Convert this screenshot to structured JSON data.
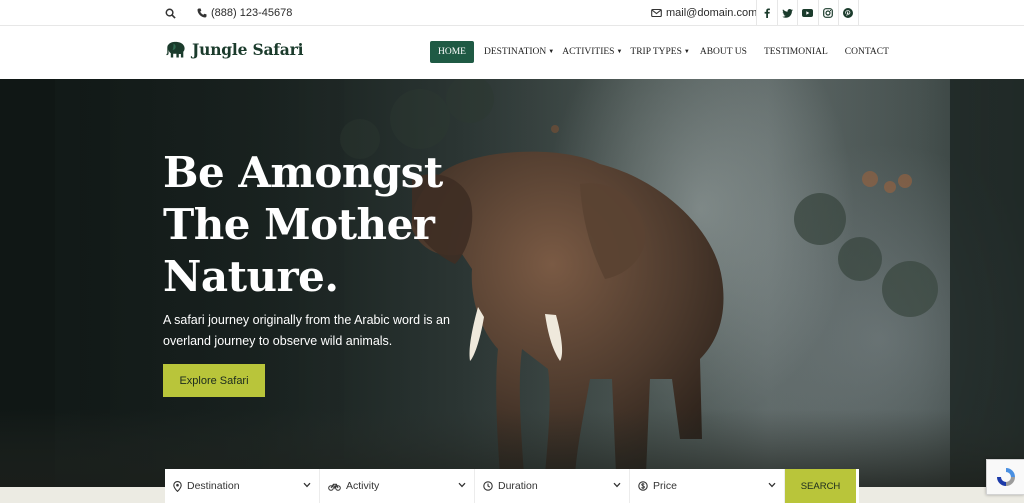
{
  "topbar": {
    "phone": "(888) 123-45678",
    "email": "mail@domain.com",
    "social": [
      "facebook-icon",
      "twitter-icon",
      "youtube-icon",
      "instagram-icon",
      "pinterest-icon"
    ]
  },
  "header": {
    "logo_text": "Jungle Safari",
    "nav": [
      {
        "label": "Home",
        "dropdown": false,
        "active": true
      },
      {
        "label": "Destination",
        "dropdown": true
      },
      {
        "label": "Activities",
        "dropdown": true
      },
      {
        "label": "Trip Types",
        "dropdown": true
      },
      {
        "label": "About Us",
        "dropdown": false
      },
      {
        "label": "Testimonial",
        "dropdown": false
      },
      {
        "label": "Contact",
        "dropdown": false
      }
    ]
  },
  "hero": {
    "title_line1": "Be Amongst",
    "title_line2": "The Mother",
    "title_line3": "Nature.",
    "subtitle": "A safari journey originally from the Arabic word is an overland journey to observe wild animals.",
    "cta_label": "Explore Safari"
  },
  "search": {
    "fields": [
      {
        "label": "Destination",
        "icon": "map-pin-icon"
      },
      {
        "label": "Activity",
        "icon": "bicycle-icon"
      },
      {
        "label": "Duration",
        "icon": "clock-icon"
      },
      {
        "label": "Price",
        "icon": "price-tag-icon"
      }
    ],
    "button_label": "SEARCH"
  },
  "colors": {
    "brand_green": "#1f5a44",
    "accent_lime": "#b9c53a"
  }
}
